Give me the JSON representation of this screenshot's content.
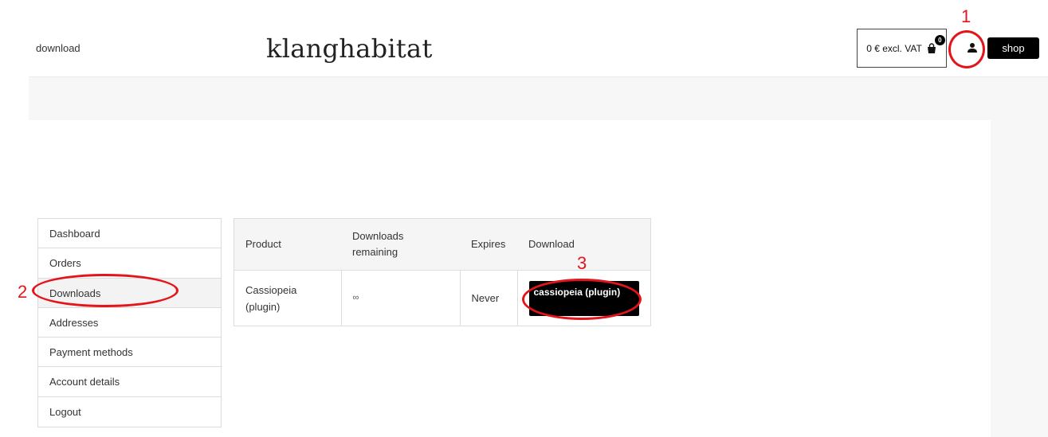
{
  "header": {
    "nav_link": "download",
    "logo": "klanghabitat",
    "cart_label": "0 € excl. VAT",
    "cart_count": "0",
    "shop_label": "shop"
  },
  "account_nav": {
    "items": [
      {
        "label": "Dashboard"
      },
      {
        "label": "Orders"
      },
      {
        "label": "Downloads"
      },
      {
        "label": "Addresses"
      },
      {
        "label": "Payment methods"
      },
      {
        "label": "Account details"
      },
      {
        "label": "Logout"
      }
    ]
  },
  "downloads_table": {
    "headers": [
      "Product",
      "Downloads remaining",
      "Expires",
      "Download"
    ],
    "rows": [
      {
        "product": "Cassiopeia (plugin)",
        "remaining": "∞",
        "expires": "Never",
        "download_label": "cassiopeia (plugin)"
      }
    ]
  },
  "annotations": {
    "labels": [
      "1",
      "2",
      "3"
    ],
    "color": "#e3151b"
  }
}
